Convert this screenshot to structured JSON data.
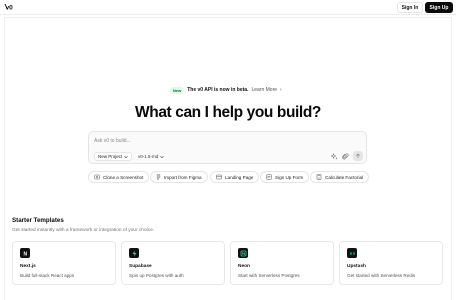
{
  "header": {
    "logo_text": "v0",
    "signin_label": "Sign In",
    "signup_label": "Sign Up"
  },
  "announcement": {
    "badge": "New",
    "text": "The v0 API is now in beta.",
    "link": "Learn More",
    "chevron": "›"
  },
  "hero": {
    "title": "What can I help you build?"
  },
  "prompt": {
    "placeholder": "Ask v0 to build...",
    "project_label": "New Project",
    "model_label": "v0-1.5-md",
    "icons": [
      "sparkle-icon",
      "paperclip-icon",
      "arrow-up-icon"
    ]
  },
  "suggestions": [
    {
      "label": "Clone a Screenshot",
      "icon": "screenshot-icon"
    },
    {
      "label": "Import from Figma",
      "icon": "figma-icon"
    },
    {
      "label": "Landing Page",
      "icon": "layout-icon"
    },
    {
      "label": "Sign Up Form",
      "icon": "user-plus-icon"
    },
    {
      "label": "Calculate Factorial",
      "icon": "calculator-icon"
    }
  ],
  "templates": {
    "title": "Starter Templates",
    "subtitle": "Get started instantly with a framework or integration of your choice.",
    "cards": [
      {
        "name": "Next.js",
        "desc": "Build full-stack React apps",
        "icon": "nextjs-icon"
      },
      {
        "name": "Supabase",
        "desc": "Spin up Postgres with auth",
        "icon": "supabase-icon"
      },
      {
        "name": "Neon",
        "desc": "Start with Serverless Postgres",
        "icon": "neon-icon"
      },
      {
        "name": "Upstash",
        "desc": "Get started with Serverless Redis",
        "icon": "upstash-icon"
      }
    ]
  },
  "colors": {
    "accent": "#0a0a0a",
    "badge_bg": "#dcfce7",
    "badge_fg": "#166534",
    "border": "#e5e5e5"
  }
}
